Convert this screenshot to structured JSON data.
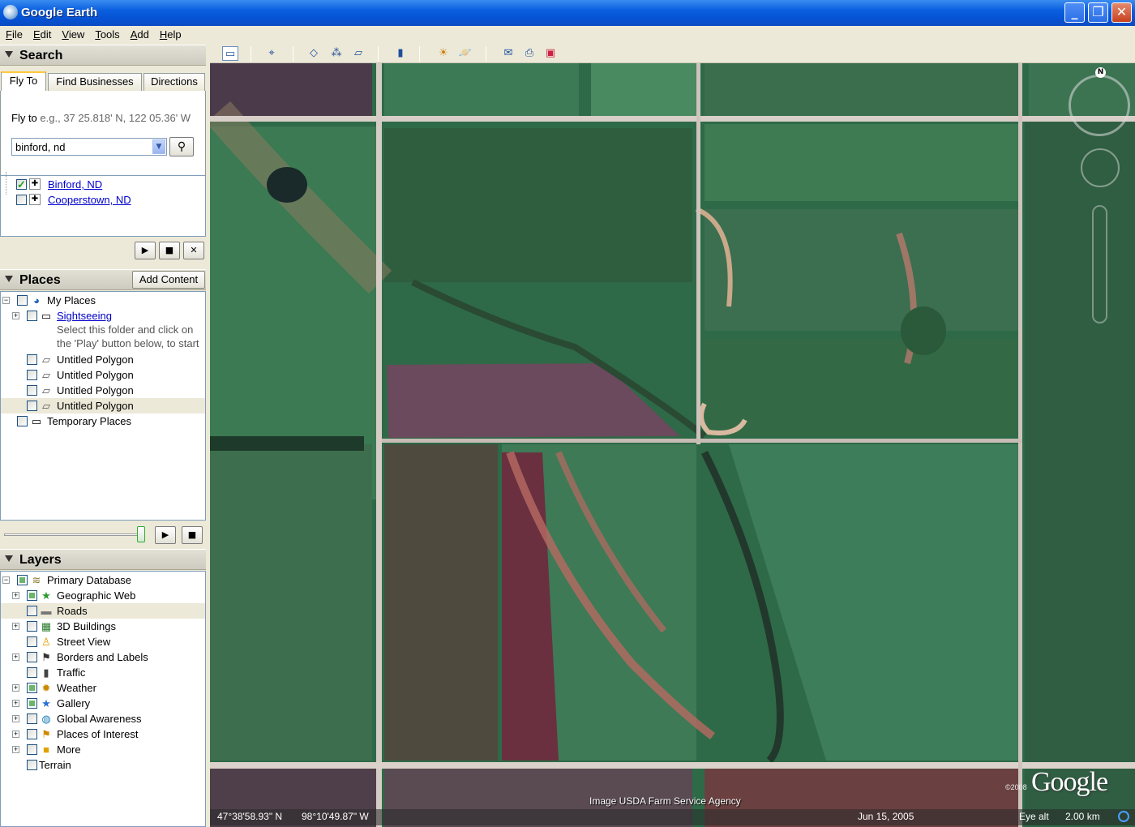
{
  "window": {
    "title": "Google Earth"
  },
  "menu": [
    "File",
    "Edit",
    "View",
    "Tools",
    "Add",
    "Help"
  ],
  "search": {
    "header": "Search",
    "tabs": [
      "Fly To",
      "Find Businesses",
      "Directions"
    ],
    "fly_to_label": "Fly to",
    "fly_to_hint": "e.g., 37 25.818' N, 122 05.36' W",
    "input_value": "binford, nd",
    "results": [
      {
        "label": "Binford, ND",
        "checked": true
      },
      {
        "label": "Cooperstown, ND",
        "checked": false
      }
    ]
  },
  "places": {
    "header": "Places",
    "add_content": "Add Content",
    "my_places": "My Places",
    "sightseeing": "Sightseeing",
    "sightseeing_desc_1": "Select this folder and click on",
    "sightseeing_desc_2": "the 'Play' button below, to start",
    "polygons": [
      "Untitled Polygon",
      "Untitled Polygon",
      "Untitled Polygon",
      "Untitled Polygon"
    ],
    "temporary": "Temporary Places"
  },
  "layers": {
    "header": "Layers",
    "primary": "Primary Database",
    "items": [
      {
        "label": "Geographic Web",
        "icon": "star-icon"
      },
      {
        "label": "Roads",
        "icon": "road-icon"
      },
      {
        "label": "3D Buildings",
        "icon": "building-icon"
      },
      {
        "label": "Street View",
        "icon": "pegman-icon"
      },
      {
        "label": "Borders and Labels",
        "icon": "flag-icon"
      },
      {
        "label": "Traffic",
        "icon": "traffic-light-icon"
      },
      {
        "label": "Weather",
        "icon": "sun-icon"
      },
      {
        "label": "Gallery",
        "icon": "star-icon"
      },
      {
        "label": "Global Awareness",
        "icon": "globe-icon"
      },
      {
        "label": "Places of Interest",
        "icon": "flag-icon"
      },
      {
        "label": "More",
        "icon": "folder-icon"
      },
      {
        "label": "Terrain",
        "icon": "none"
      }
    ]
  },
  "map": {
    "credit": "Image USDA Farm Service Agency",
    "logo": "Google",
    "copyright": "©2008",
    "lat": "47°38'58.93\" N",
    "lon": "98°10'49.87\" W",
    "date": "Jun 15, 2005",
    "eye_alt_label": "Eye alt",
    "eye_alt_value": "2.00 km",
    "compass_north": "N"
  }
}
